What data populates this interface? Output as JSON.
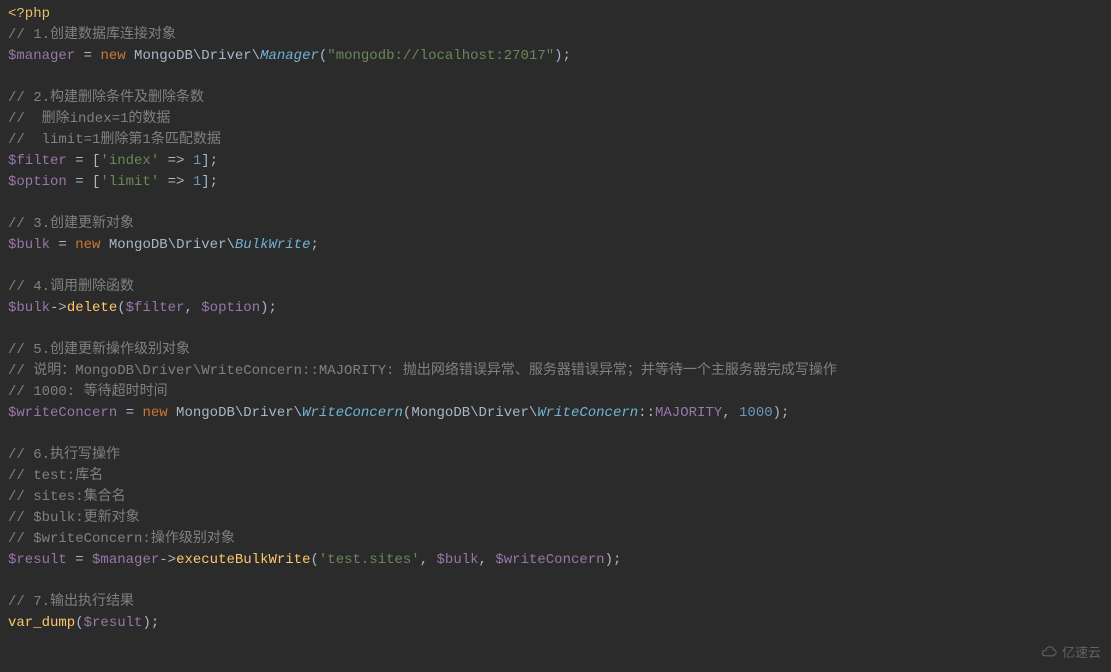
{
  "code": {
    "line1_open": "<?php",
    "line2_comment": "// 1.创建数据库连接对象",
    "line3_var": "$manager",
    "line3_assign": " = ",
    "line3_new": "new",
    "line3_ns": " MongoDB\\Driver\\",
    "line3_class": "Manager",
    "line3_paren_open": "(",
    "line3_str": "\"mongodb://localhost:27017\"",
    "line3_end": ");",
    "line5_comment": "// 2.构建删除条件及删除条数",
    "line6_comment": "//  删除index=1的数据",
    "line7_comment": "//  limit=1删除第1条匹配数据",
    "line8_var": "$filter",
    "line8_assign": " = [",
    "line8_key": "'index'",
    "line8_arrow": " => ",
    "line8_val": "1",
    "line8_end": "];",
    "line9_var": "$option",
    "line9_assign": " = [",
    "line9_key": "'limit'",
    "line9_arrow": " => ",
    "line9_val": "1",
    "line9_end": "];",
    "line11_comment": "// 3.创建更新对象",
    "line12_var": "$bulk",
    "line12_assign": " = ",
    "line12_new": "new",
    "line12_ns": " MongoDB\\Driver\\",
    "line12_class": "BulkWrite",
    "line12_end": ";",
    "line14_comment": "// 4.调用删除函数",
    "line15_var": "$bulk",
    "line15_arrow": "->",
    "line15_func": "delete",
    "line15_open": "(",
    "line15_arg1": "$filter",
    "line15_comma": ", ",
    "line15_arg2": "$option",
    "line15_end": ");",
    "line17_comment": "// 5.创建更新操作级别对象",
    "line18_comment": "// 说明：MongoDB\\Driver\\WriteConcern::MAJORITY: 抛出网络错误异常、服务器错误异常；并等待一个主服务器完成写操作",
    "line19_comment": "// 1000: 等待超时时间",
    "line20_var": "$writeConcern",
    "line20_assign": " = ",
    "line20_new": "new",
    "line20_ns1": " MongoDB\\Driver\\",
    "line20_class1": "WriteConcern",
    "line20_open": "(",
    "line20_ns2": "MongoDB\\Driver\\",
    "line20_class2": "WriteConcern",
    "line20_dc": "::",
    "line20_const": "MAJORITY",
    "line20_comma": ", ",
    "line20_num": "1000",
    "line20_end": ");",
    "line22_comment": "// 6.执行写操作",
    "line23_comment": "// test:库名",
    "line24_comment": "// sites:集合名",
    "line25_comment": "// $bulk:更新对象",
    "line26_comment": "// $writeConcern:操作级别对象",
    "line27_var": "$result",
    "line27_assign": " = ",
    "line27_var2": "$manager",
    "line27_arrow": "->",
    "line27_func": "executeBulkWrite",
    "line27_open": "(",
    "line27_str": "'test.sites'",
    "line27_c1": ", ",
    "line27_arg2": "$bulk",
    "line27_c2": ", ",
    "line27_arg3": "$writeConcern",
    "line27_end": ");",
    "line29_comment": "// 7.输出执行结果",
    "line30_func": "var_dump",
    "line30_open": "(",
    "line30_arg": "$result",
    "line30_end": ");"
  },
  "watermark": "亿速云"
}
